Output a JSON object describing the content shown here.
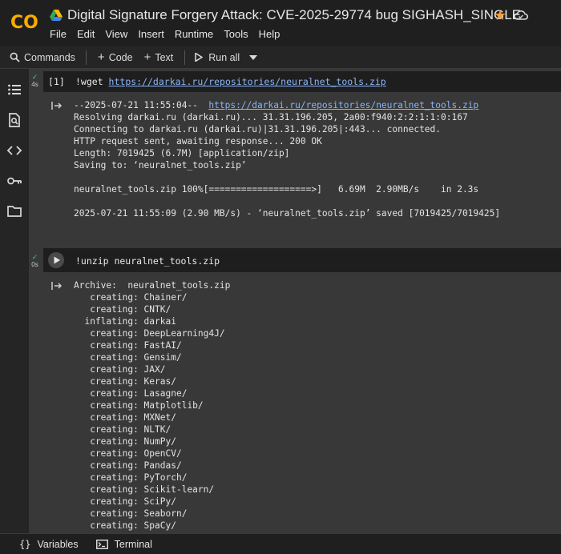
{
  "header": {
    "logo_text": "CO",
    "title": "Digital Signature Forgery Attack: CVE-2025-29774 bug SIGHASH_SINGLE",
    "menu": [
      "File",
      "Edit",
      "View",
      "Insert",
      "Runtime",
      "Tools",
      "Help"
    ]
  },
  "toolbar": {
    "commands": "Commands",
    "code": "Code",
    "text": "Text",
    "run_all": "Run all"
  },
  "cell1": {
    "time": "4s",
    "prompt": "[1]",
    "code_prefix": "!wget ",
    "code_url": "https://darkai.ru/repositories/neuralnet_tools.zip",
    "output": {
      "l1_prefix": "--2025-07-21 11:55:04--  ",
      "l1_url": "https://darkai.ru/repositories/neuralnet_tools.zip",
      "lines": [
        "Resolving darkai.ru (darkai.ru)... 31.31.196.205, 2a00:f940:2:2:1:1:0:167",
        "Connecting to darkai.ru (darkai.ru)|31.31.196.205|:443... connected.",
        "HTTP request sent, awaiting response... 200 OK",
        "Length: 7019425 (6.7M) [application/zip]",
        "Saving to: ‘neuralnet_tools.zip’",
        "",
        "neuralnet_tools.zip 100%[===================>]   6.69M  2.90MB/s    in 2.3s",
        "",
        "2025-07-21 11:55:09 (2.90 MB/s) - ‘neuralnet_tools.zip’ saved [7019425/7019425]"
      ]
    }
  },
  "cell2": {
    "time": "0s",
    "code": "!unzip neuralnet_tools.zip",
    "output": [
      "Archive:  neuralnet_tools.zip",
      "   creating: Chainer/",
      "   creating: CNTK/",
      "  inflating: darkai",
      "   creating: DeepLearning4J/",
      "   creating: FastAI/",
      "   creating: Gensim/",
      "   creating: JAX/",
      "   creating: Keras/",
      "   creating: Lasagne/",
      "   creating: Matplotlib/",
      "   creating: MXNet/",
      "   creating: NLTK/",
      "   creating: NumPy/",
      "   creating: OpenCV/",
      "   creating: Pandas/",
      "   creating: PyTorch/",
      "   creating: Scikit-learn/",
      "   creating: SciPy/",
      "   creating: Seaborn/",
      "   creating: SpaCy/"
    ]
  },
  "footer": {
    "variables": "Variables",
    "terminal": "Terminal"
  },
  "colors": {
    "accent_orange": "#f59d3d",
    "link": "#8ab4f8",
    "success": "#5fbf6b"
  }
}
